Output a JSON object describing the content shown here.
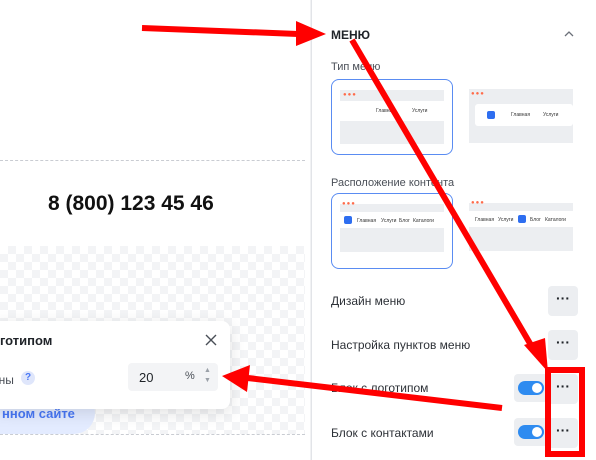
{
  "canvas": {
    "phone": "8 (800) 123 45 46",
    "site_button": "нном сайте"
  },
  "popup": {
    "title": "оготипом",
    "field_label": "оны",
    "help_icon": "?",
    "value": "20",
    "unit": "%"
  },
  "panel": {
    "title": "МЕНЮ",
    "menu_type_label": "Тип меню",
    "menu_type_options": [
      {
        "home": "Главная",
        "services": "Услуги"
      },
      {
        "home": "Главная",
        "services": "Услуги"
      }
    ],
    "content_position_label": "Расположение контента",
    "content_position_options": [
      [
        "Главная",
        "Услуги",
        "Блог",
        "Каталоги"
      ],
      [
        "Главная",
        "Услуги",
        "Блог",
        "Каталоги"
      ]
    ],
    "rows": [
      {
        "label": "Дизайн меню",
        "button": "···"
      },
      {
        "label": "Настройка пунктов меню",
        "button": "···"
      },
      {
        "label": "Блок с логотипом",
        "button": "···"
      },
      {
        "label": "Блок с контактами",
        "button": "···"
      }
    ]
  },
  "colors": {
    "accent": "#2e8bf0",
    "annotation": "#ff0000",
    "selected_border": "#5a8cf2"
  }
}
